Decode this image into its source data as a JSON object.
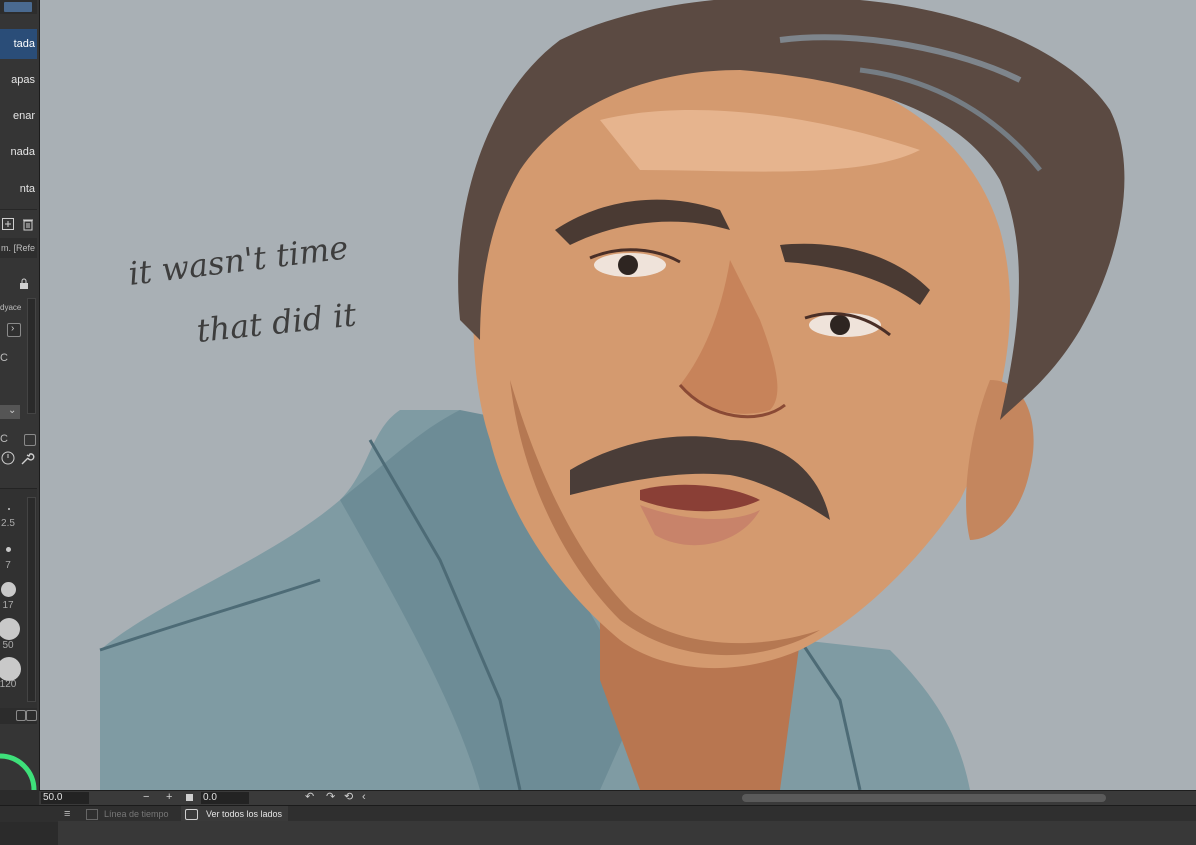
{
  "left_panel": {
    "subtool_items": [
      {
        "label": "tada",
        "active": true
      },
      {
        "label": "apas",
        "active": false
      },
      {
        "label": "enar",
        "active": false
      },
      {
        "label": "nada",
        "active": false
      },
      {
        "label": "nta",
        "active": false
      }
    ],
    "property_texts": [
      "m. [Refe",
      "dyace",
      "C",
      "C"
    ],
    "brush_sizes": [
      "2.5",
      "7",
      "17",
      "50",
      "120"
    ]
  },
  "canvas": {
    "handwritten_line1": "it wasn't time",
    "handwritten_line2": "that did it",
    "background_color": "#a9b0b5"
  },
  "status_bar": {
    "zoom": "50.0",
    "angle": "0.0",
    "minus": "−",
    "plus": "+"
  },
  "bottom_tabs": {
    "timeline": "Línea de tiempo",
    "view_all_sides": "Ver todos los lados"
  },
  "icons": [
    "plus-square-icon",
    "trash-icon",
    "lock-icon",
    "rotate-left-icon",
    "rotate-right-icon",
    "reset-icon",
    "chevron-left-icon",
    "menu-icon",
    "camera-icon"
  ],
  "accent_colors": {
    "active_item": "#2a4d78",
    "ring": "#3ee07a"
  }
}
